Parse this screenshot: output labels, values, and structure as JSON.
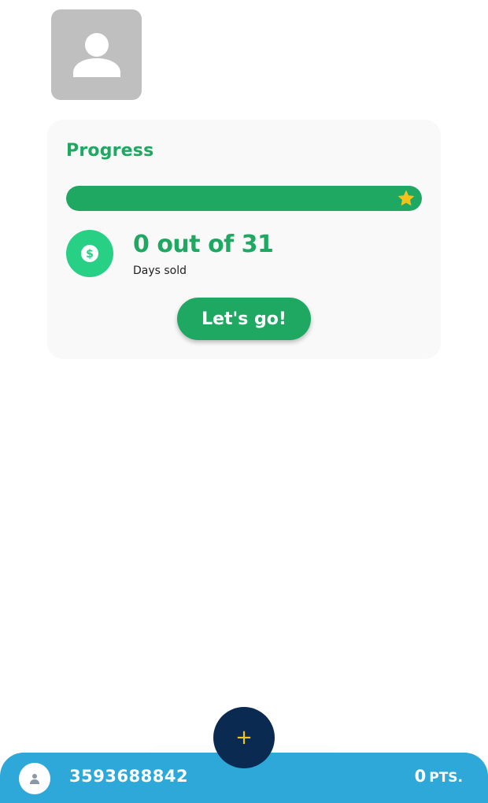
{
  "profile": {
    "avatar_icon": "person-icon"
  },
  "progress_card": {
    "title": "Progress",
    "progress_fraction": 1.0,
    "progress_end_icon": "star-icon",
    "coin_icon": "dollar-icon",
    "days_count": "0 out of 31",
    "days_label": "Days sold",
    "cta_label": "Let's go!"
  },
  "fab": {
    "label": "+",
    "icon": "plus-icon"
  },
  "bottom_bar": {
    "avatar_icon": "user-icon",
    "phone": "3593688842",
    "points_value": "0",
    "points_unit": "PTS."
  },
  "colors": {
    "accent_green": "#1ea862",
    "coin_green": "#28d086",
    "bar_blue": "#2ea8d9",
    "fab_navy": "#0b2a52",
    "star_yellow": "#f5c21b"
  }
}
